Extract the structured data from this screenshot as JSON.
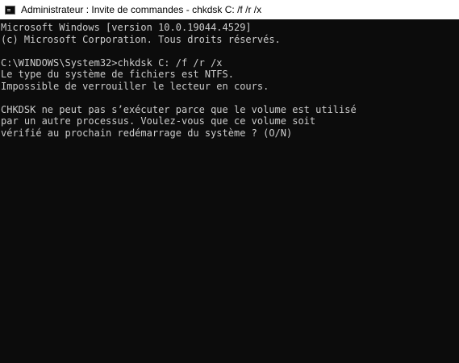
{
  "window": {
    "title": "Administrateur : Invite de commandes - chkdsk  C: /f /r /x",
    "icon": "cmd-icon"
  },
  "console": {
    "lines": [
      "Microsoft Windows [version 10.0.19044.4529]",
      "(c) Microsoft Corporation. Tous droits réservés.",
      "",
      "C:\\WINDOWS\\System32>chkdsk C: /f /r /x",
      "Le type du système de fichiers est NTFS.",
      "Impossible de verrouiller le lecteur en cours.",
      "",
      "CHKDSK ne peut pas s’exécuter parce que le volume est utilisé",
      "par un autre processus. Voulez-vous que ce volume soit",
      "vérifié au prochain redémarrage du système ? (O/N)"
    ]
  },
  "colors": {
    "console_background": "#0c0c0c",
    "console_text": "#cccccc",
    "titlebar_background": "#ffffff",
    "titlebar_text": "#000000"
  }
}
